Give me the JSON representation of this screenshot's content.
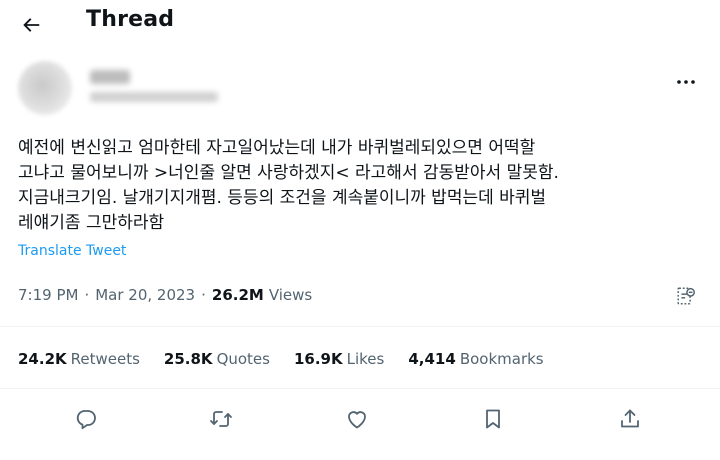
{
  "header": {
    "title": "Thread",
    "back_icon": "arrow-left-icon"
  },
  "author": {
    "name": "",
    "handle": "",
    "more_icon": "more-horizontal-icon"
  },
  "tweet": {
    "text": "예전에 변신읽고 엄마한테 자고일어났는데 내가 바퀴벌레되있으면 어떡할\n고냐고 물어보니까 >너인줄 알면 사랑하겠지< 라고해서 감동받아서 말못함.\n지금내크기임. 날개기지개폄. 등등의 조건을 계속붙이니까 밥먹는데 바퀴벌\n레얘기좀 그만하라함",
    "translate_label": "Translate Tweet"
  },
  "meta": {
    "time": "7:19 PM",
    "separator": "·",
    "date": "Mar 20, 2023",
    "views_count": "26.2M",
    "views_label": "Views",
    "analytics_icon": "analytics-icon"
  },
  "stats": {
    "retweets": {
      "count": "24.2K",
      "label": "Retweets"
    },
    "quotes": {
      "count": "25.8K",
      "label": "Quotes"
    },
    "likes": {
      "count": "16.9K",
      "label": "Likes"
    },
    "bookmarks": {
      "count": "4,414",
      "label": "Bookmarks"
    }
  },
  "actions": [
    "reply-icon",
    "retweet-icon",
    "like-icon",
    "bookmark-icon",
    "share-icon"
  ],
  "colors": {
    "text": "#0f1419",
    "secondary": "#536471",
    "link": "#1d9bf0",
    "divider": "#eff3f4"
  }
}
